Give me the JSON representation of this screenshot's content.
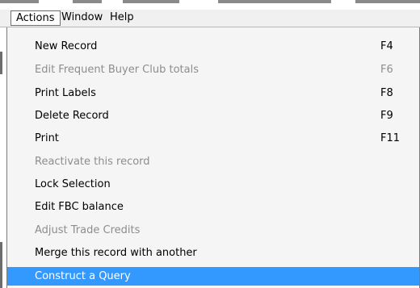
{
  "menubar": {
    "items": [
      {
        "label": "Actions"
      },
      {
        "label": "Window"
      },
      {
        "label": "Help"
      }
    ]
  },
  "menu": {
    "items": [
      {
        "label": "New Record",
        "shortcut": "F4",
        "enabled": true
      },
      {
        "label": "Edit Frequent Buyer Club totals",
        "shortcut": "F6",
        "enabled": false
      },
      {
        "label": "Print Labels",
        "shortcut": "F8",
        "enabled": true
      },
      {
        "label": "Delete Record",
        "shortcut": "F9",
        "enabled": true
      },
      {
        "label": "Print",
        "shortcut": "F11",
        "enabled": true
      },
      {
        "label": "Reactivate this record",
        "shortcut": "",
        "enabled": false
      },
      {
        "label": "Lock Selection",
        "shortcut": "",
        "enabled": true
      },
      {
        "label": "Edit FBC balance",
        "shortcut": "",
        "enabled": true
      },
      {
        "label": "Adjust Trade Credits",
        "shortcut": "",
        "enabled": false
      },
      {
        "label": "Merge this record with another",
        "shortcut": "",
        "enabled": true
      },
      {
        "label": "Construct a Query",
        "shortcut": "",
        "enabled": true,
        "highlighted": true
      }
    ]
  },
  "colors": {
    "highlight": "#3399ff",
    "disabled_text": "#8d8d8d",
    "menu_background": "#f5f5f5"
  }
}
